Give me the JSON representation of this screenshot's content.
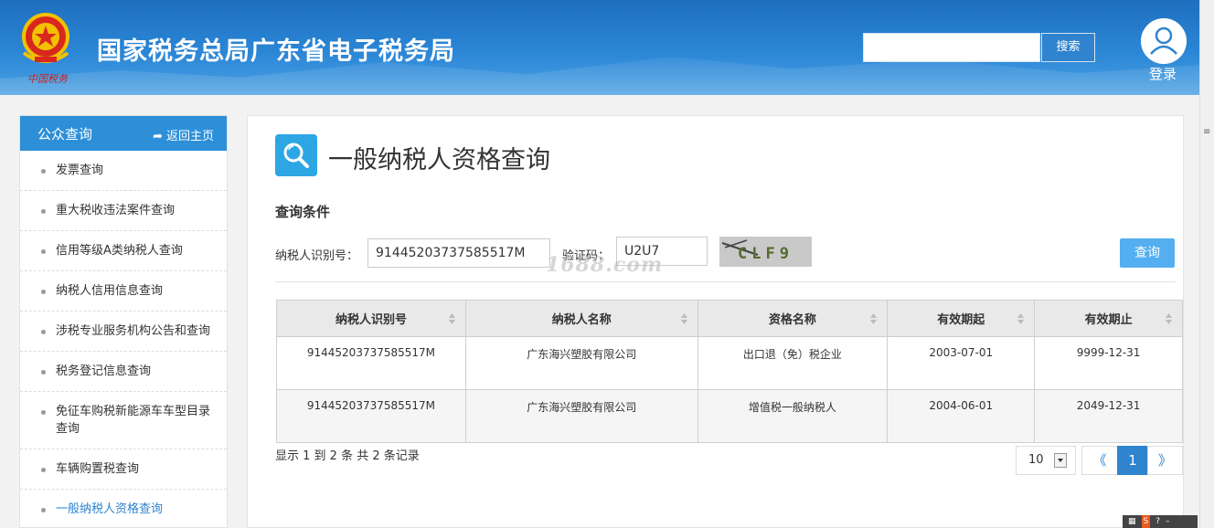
{
  "header": {
    "site_title": "国家税务总局广东省电子税务局",
    "emblem_text": "中国税务",
    "search_placeholder": "",
    "search_button": "搜索",
    "login_label": "登录"
  },
  "sidebar": {
    "title": "公众查询",
    "back_label": "返回主页",
    "items": [
      {
        "label": "发票查询"
      },
      {
        "label": "重大税收违法案件查询"
      },
      {
        "label": "信用等级A类纳税人查询"
      },
      {
        "label": "纳税人信用信息查询"
      },
      {
        "label": "涉税专业服务机构公告和查询"
      },
      {
        "label": "税务登记信息查询"
      },
      {
        "label": "免征车购税新能源车车型目录查询"
      },
      {
        "label": "车辆购置税查询"
      },
      {
        "label": "一般纳税人资格查询"
      }
    ]
  },
  "main": {
    "page_title": "一般纳税人资格查询",
    "section_label": "查询条件",
    "taxpayer_id_label": "纳税人识别号：",
    "taxpayer_id_value": "91445203737585517M",
    "captcha_label": "验证码：",
    "captcha_value": "U2U7",
    "captcha_image_text": "CLF9",
    "watermark": "1688.com",
    "query_button": "查询",
    "table": {
      "headers": [
        "纳税人识别号",
        "纳税人名称",
        "资格名称",
        "有效期起",
        "有效期止"
      ],
      "rows": [
        [
          "91445203737585517M",
          "广东海兴塑胶有限公司",
          "出口退（免）税企业",
          "2003-07-01",
          "9999-12-31"
        ],
        [
          "91445203737585517M",
          "广东海兴塑胶有限公司",
          "增值税一般纳税人",
          "2004-06-01",
          "2049-12-31"
        ]
      ]
    },
    "pagination": {
      "info": "显示 1 到 2 条 共 2 条记录",
      "page_size": "10",
      "prev": "《",
      "current": "1",
      "next": "》"
    }
  },
  "colors": {
    "header_blue": "#2b86d6",
    "accent_blue": "#2f83cf",
    "button_blue": "#54aef0"
  }
}
